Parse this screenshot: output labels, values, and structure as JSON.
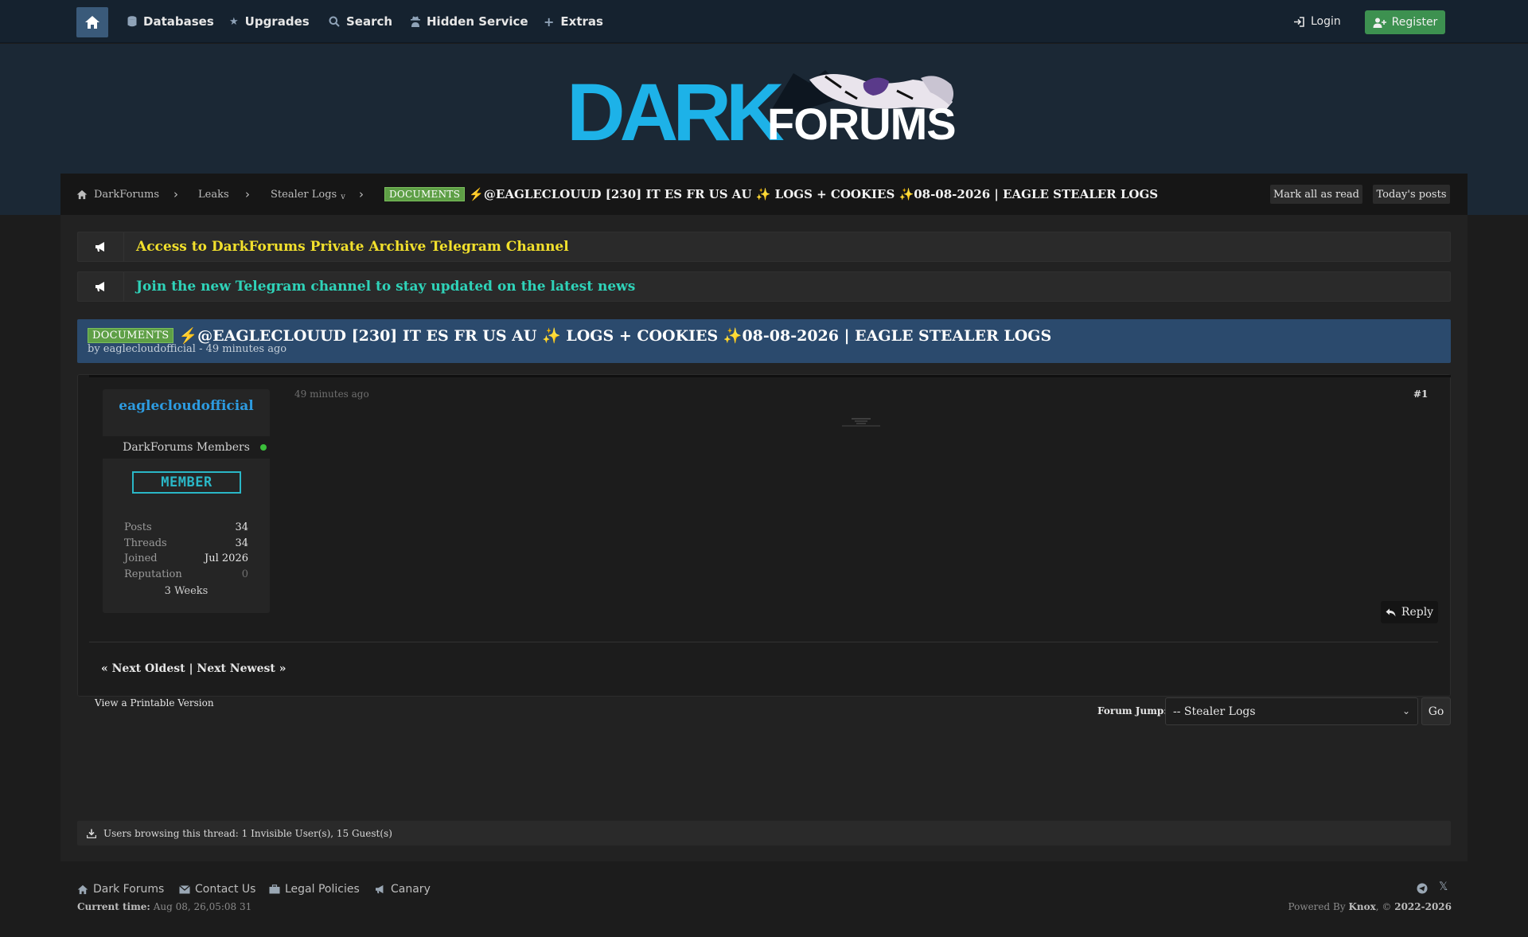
{
  "nav": {
    "items": [
      {
        "label": "Databases",
        "icon": "database-icon"
      },
      {
        "label": "Upgrades",
        "icon": "star-icon"
      },
      {
        "label": "Search",
        "icon": "search-icon"
      },
      {
        "label": "Hidden Service",
        "icon": "user-secret-icon"
      },
      {
        "label": "Extras",
        "icon": "plus-icon"
      }
    ],
    "login": "Login",
    "register": "Register"
  },
  "logo": {
    "dark": "DARK",
    "forums": "FORUMS"
  },
  "breadcrumb": {
    "items": [
      "DarkForums",
      "Leaks",
      "Stealer Logs"
    ],
    "stealer_caret": "v",
    "prefix": "DOCUMENTS",
    "title": "⚡@EAGLECLOUUD [230] IT ES FR US AU ✨ LOGS + COOKIES ✨08-08-2026 | EAGLE STEALER LOGS",
    "mark_read": "Mark all as read",
    "todays_posts": "Today's posts"
  },
  "notices": [
    {
      "text": "Access to DarkForums Private Archive Telegram Channel",
      "color": "#f2e02c"
    },
    {
      "text": "Join the new Telegram channel to stay updated on the latest news",
      "color": "#2fd3b9"
    }
  ],
  "thread": {
    "prefix": "DOCUMENTS",
    "title": "⚡@EAGLECLOUUD [230] IT ES FR US AU ✨ LOGS + COOKIES ✨08-08-2026 | EAGLE STEALER LOGS",
    "byline": "by eaglecloudofficial - 49 minutes ago"
  },
  "post": {
    "username": "eaglecloudofficial",
    "group": "DarkForums Members",
    "badge": "MEMBER",
    "stats": [
      {
        "label": "Posts",
        "value": "34"
      },
      {
        "label": "Threads",
        "value": "34"
      },
      {
        "label": "Joined",
        "value": "Jul 2026"
      },
      {
        "label": "Reputation",
        "value": "0"
      }
    ],
    "time_online": "3 Weeks",
    "date": "49 minutes ago",
    "number": "#1",
    "reply": "Reply"
  },
  "pagination": {
    "text": "« Next Oldest | Next Newest »"
  },
  "printable": "View a Printable Version",
  "forum_jump": {
    "label": "Forum Jump:",
    "selected": "-- Stealer Logs",
    "go": "Go"
  },
  "browsing": "Users browsing this thread: 1 Invisible User(s), 15 Guest(s)",
  "footer": {
    "links": [
      "Dark Forums",
      "Contact Us",
      "Legal Policies",
      "Canary"
    ],
    "current_time_label": "Current time:",
    "current_time": "Aug 08, 26,05:08 31",
    "powered_prefix": "Powered By",
    "powered_by": "Knox",
    "copyright": "2022-2026"
  }
}
